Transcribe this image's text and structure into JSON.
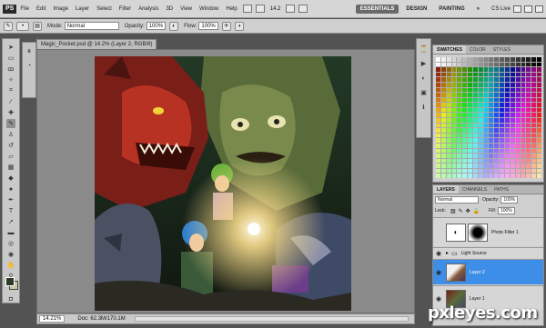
{
  "app": {
    "logo": "PS",
    "zoom_readout": "14.2"
  },
  "menu": [
    "File",
    "Edit",
    "Image",
    "Layer",
    "Select",
    "Filter",
    "Analysis",
    "3D",
    "View",
    "Window",
    "Help"
  ],
  "workspaces": {
    "essentials": "ESSENTIALS",
    "design": "DESIGN",
    "painting": "PAINTING",
    "more": "»",
    "cslive": "CS Live"
  },
  "options": {
    "mode_label": "Mode:",
    "mode_value": "Normal",
    "opacity_label": "Opacity:",
    "opacity_value": "100%",
    "flow_label": "Flow:",
    "flow_value": "100%"
  },
  "document": {
    "tab_title": "Magic_Pocket.psd @ 14.2% (Layer 2, RGB/8)",
    "zoom": "14.21%",
    "doc_size": "Doc: 62.3M/170.1M"
  },
  "swatches_panel": {
    "tabs": [
      "SWATCHES",
      "COLOR",
      "STYLES"
    ]
  },
  "layers_panel": {
    "tabs": [
      "LAYERS",
      "CHANNELS",
      "PATHS"
    ],
    "blend_mode": "Normal",
    "opacity_label": "Opacity:",
    "opacity_value": "100%",
    "lock_label": "Lock:",
    "fill_label": "Fill:",
    "fill_value": "100%",
    "layers": [
      {
        "name": "Photo Filter 1",
        "visible": false,
        "selected": false
      },
      {
        "name": "Light Source",
        "visible": true,
        "selected": false
      },
      {
        "name": "Layer 2",
        "visible": true,
        "selected": true
      },
      {
        "name": "Layer 1",
        "visible": true,
        "selected": false
      }
    ]
  },
  "watermark": "pxleyes.com",
  "colors": {
    "selected_layer": "#3d8ee8",
    "ui_gray": "#cfcfcf",
    "canvas_bg": "#8a8a8a"
  }
}
